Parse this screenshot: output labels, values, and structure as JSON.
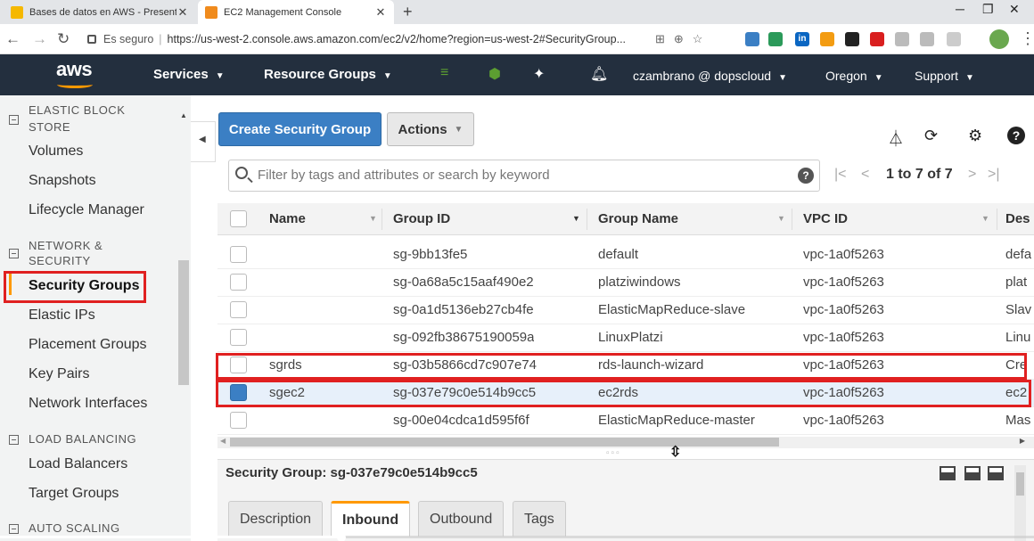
{
  "browser": {
    "tabs": [
      {
        "title": "Bases de datos en AWS - Present",
        "active": false
      },
      {
        "title": "EC2 Management Console",
        "active": true
      }
    ],
    "close_glyph": "✕",
    "new_tab_glyph": "+",
    "secure_label": "Es seguro",
    "url": "https://us-west-2.console.aws.amazon.com/ec2/v2/home?region=us-west-2#SecurityGroup..."
  },
  "aws_header": {
    "logo": "aws",
    "services": "Services",
    "resource_groups": "Resource Groups",
    "user": "czambrano @ dopscloud",
    "region": "Oregon",
    "support": "Support"
  },
  "sidebar": {
    "groups": {
      "elastic_block_store_top": "ELASTIC BLOCK",
      "elastic_block_store": "STORE",
      "network_security": "NETWORK &",
      "network_security_2": "SECURITY",
      "load_balancing": "LOAD BALANCING",
      "auto_scaling": "AUTO SCALING"
    },
    "items": {
      "volumes": "Volumes",
      "snapshots": "Snapshots",
      "lifecycle_manager": "Lifecycle Manager",
      "security_groups": "Security Groups",
      "elastic_ips": "Elastic IPs",
      "placement_groups": "Placement Groups",
      "key_pairs": "Key Pairs",
      "network_interfaces": "Network Interfaces",
      "load_balancers": "Load Balancers",
      "target_groups": "Target Groups"
    },
    "active_item": "Security Groups"
  },
  "toolbar": {
    "create_label": "Create Security Group",
    "actions_label": "Actions"
  },
  "filter": {
    "placeholder": "Filter by tags and attributes or search by keyword",
    "help": "?"
  },
  "pagination": {
    "text": "1 to 7 of 7"
  },
  "table": {
    "columns": [
      "Name",
      "Group ID",
      "Group Name",
      "VPC ID",
      "Des"
    ],
    "rows": [
      {
        "name": "",
        "group_id": "sg-9bb13fe5",
        "group_name": "default",
        "vpc_id": "vpc-1a0f5263",
        "description": "defa",
        "selected": false
      },
      {
        "name": "",
        "group_id": "sg-0a68a5c15aaf490e2",
        "group_name": "platziwindows",
        "vpc_id": "vpc-1a0f5263",
        "description": "plat",
        "selected": false
      },
      {
        "name": "",
        "group_id": "sg-0a1d5136eb27cb4fe",
        "group_name": "ElasticMapReduce-slave",
        "vpc_id": "vpc-1a0f5263",
        "description": "Slav",
        "selected": false
      },
      {
        "name": "",
        "group_id": "sg-092fb38675190059a",
        "group_name": "LinuxPlatzi",
        "vpc_id": "vpc-1a0f5263",
        "description": "Linu",
        "selected": false
      },
      {
        "name": "sgrds",
        "group_id": "sg-03b5866cd7c907e74",
        "group_name": "rds-launch-wizard",
        "vpc_id": "vpc-1a0f5263",
        "description": "Cre",
        "selected": false
      },
      {
        "name": "sgec2",
        "group_id": "sg-037e79c0e514b9cc5",
        "group_name": "ec2rds",
        "vpc_id": "vpc-1a0f5263",
        "description": "ec2",
        "selected": true
      },
      {
        "name": "",
        "group_id": "sg-00e04cdca1d595f6f",
        "group_name": "ElasticMapReduce-master",
        "vpc_id": "vpc-1a0f5263",
        "description": "Mas",
        "selected": false
      }
    ]
  },
  "detail": {
    "title": "Security Group: sg-037e79c0e514b9cc5",
    "tabs": [
      "Description",
      "Inbound",
      "Outbound",
      "Tags"
    ],
    "active_tab": "Inbound"
  },
  "video": {
    "progress_fraction": 0.33
  },
  "colors": {
    "aws_header": "#232f3e",
    "primary_button": "#3b7fc4",
    "highlight_box": "#e02020",
    "accent": "#ff9900"
  }
}
